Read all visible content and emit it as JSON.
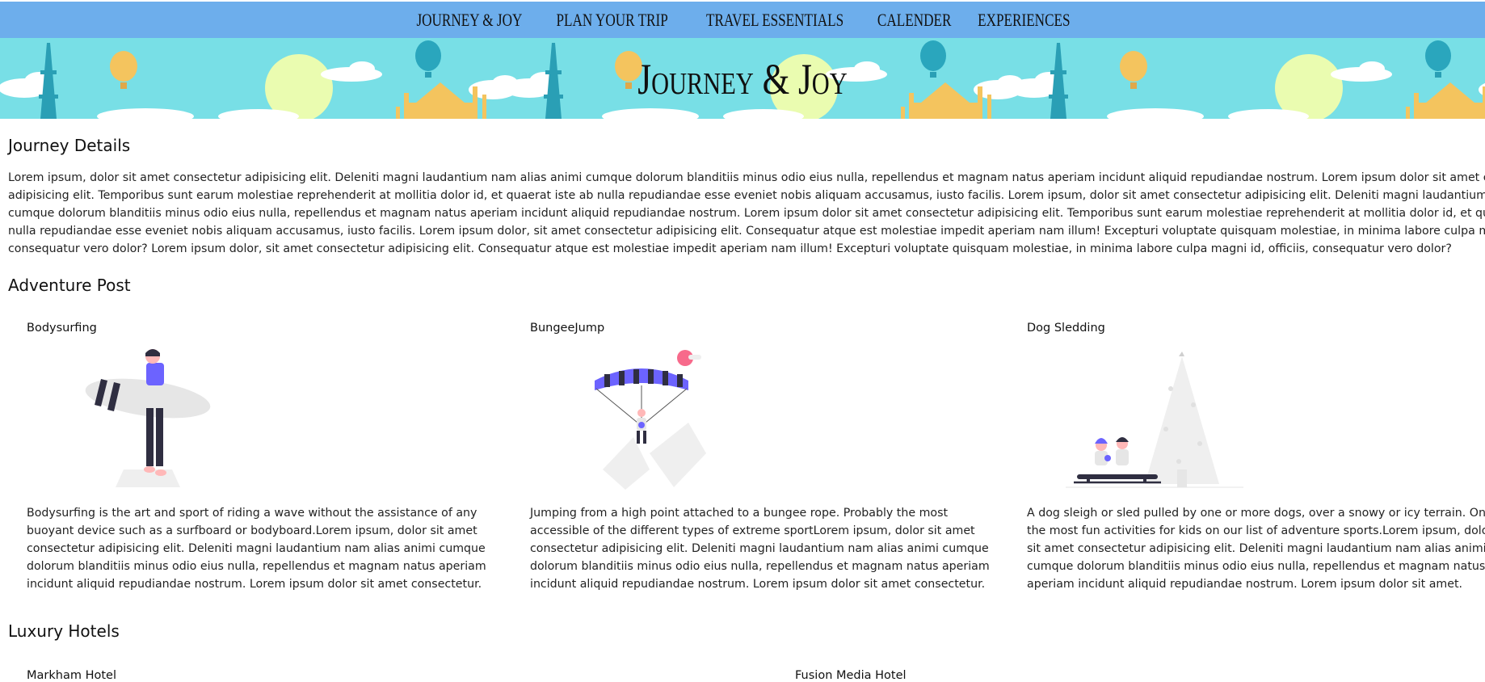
{
  "nav": {
    "items": [
      "Journey & Joy",
      "Plan Your Trip",
      "Travel Essentials",
      "Calender",
      "Experiences"
    ]
  },
  "banner": {
    "title": "Journey & Joy"
  },
  "journey": {
    "heading": "Journey Details",
    "lines": [
      "Lorem ipsum, dolor sit amet consectetur adipisicing elit. Deleniti magni laudantium nam alias animi cumque dolorum blanditiis minus odio eius nulla, repellendus et magnam natus aperiam incidunt aliquid repudiandae nostrum. Lorem ipsum dolor sit amet consectetur",
      "adipisicing elit. Temporibus sunt earum molestiae reprehenderit at mollitia dolor id, et quaerat iste ab nulla repudiandae esse eveniet nobis aliquam accusamus, iusto facilis. Lorem ipsum, dolor sit amet consectetur adipisicing elit. Deleniti magni laudantium nam alias animi",
      "cumque dolorum blanditiis minus odio eius nulla, repellendus et magnam natus aperiam incidunt aliquid repudiandae nostrum. Lorem ipsum dolor sit amet consectetur adipisicing elit. Temporibus sunt earum molestiae reprehenderit at mollitia dolor id, et quaerat iste ab",
      "nulla repudiandae esse eveniet nobis aliquam accusamus, iusto facilis. Lorem ipsum dolor, sit amet consectetur adipisicing elit. Consequatur atque est molestiae impedit aperiam nam illum! Excepturi voluptate quisquam molestiae, in minima labore culpa magni id, officiis,",
      "consequatur vero dolor? Lorem ipsum dolor, sit amet consectetur adipisicing elit. Consequatur atque est molestiae impedit aperiam nam illum! Excepturi voluptate quisquam molestiae, in minima labore culpa magni id, officiis, consequatur vero dolor?"
    ]
  },
  "adventure": {
    "heading": "Adventure Post",
    "posts": [
      {
        "title": "Bodysurfing",
        "lines": [
          "Bodysurfing is the art and sport of riding a wave without the assistance of any",
          "buoyant device such as a surfboard or bodyboard.Lorem ipsum, dolor sit amet",
          "consectetur adipisicing elit. Deleniti magni laudantium nam alias animi cumque",
          "dolorum blanditiis minus odio eius nulla, repellendus et magnam natus aperiam",
          "incidunt aliquid repudiandae nostrum. Lorem ipsum dolor sit amet consectetur."
        ]
      },
      {
        "title": "BungeeJump",
        "lines": [
          "Jumping from a high point attached to a bungee rope. Probably the most",
          "accessible of the different types of extreme sportLorem ipsum, dolor sit amet",
          "consectetur adipisicing elit. Deleniti magni laudantium nam alias animi cumque",
          "dolorum blanditiis minus odio eius nulla, repellendus et magnam natus aperiam",
          "incidunt aliquid repudiandae nostrum. Lorem ipsum dolor sit amet consectetur."
        ]
      },
      {
        "title": "Dog Sledding",
        "lines": [
          "A dog sleigh or sled pulled by one or more dogs, over a snowy or icy terrain. One of",
          "the most fun activities for kids on our list of adventure sports.Lorem ipsum, dolor",
          "sit amet consectetur adipisicing elit. Deleniti magni laudantium nam alias animi",
          "cumque dolorum blanditiis minus odio eius nulla, repellendus et magnam natus",
          "aperiam incidunt aliquid repudiandae nostrum. Lorem ipsum dolor sit amet."
        ]
      }
    ]
  },
  "hotels": {
    "heading": "Luxury Hotels",
    "items": [
      "Markham Hotel",
      "Fusion Media Hotel"
    ]
  },
  "colors": {
    "nav_bg": "#6daeec",
    "banner_bg": "#78dfe6",
    "accent_purple": "#6c63ff",
    "sun": "#eafcb0",
    "tower": "#2a9fb5",
    "balloon": "#f4c45e"
  }
}
